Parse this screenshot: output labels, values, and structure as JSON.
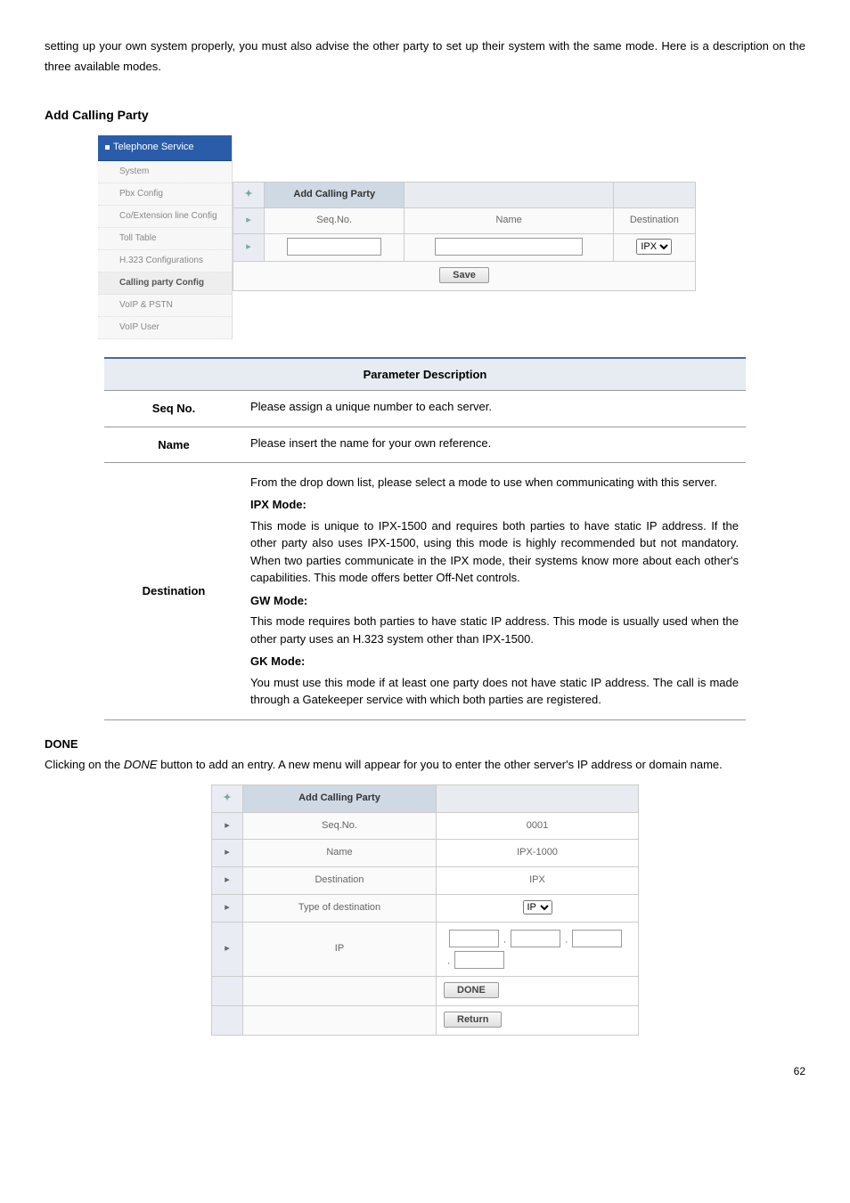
{
  "intro": "setting up your own system properly, you must also advise the other party to set up their system with the same mode. Here is a description on the three available modes.",
  "section_title": "Add Calling Party",
  "sidebar": {
    "header": "Telephone Service",
    "items": [
      {
        "label": "System"
      },
      {
        "label": "Pbx Config"
      },
      {
        "label": "Co/Extension line Config"
      },
      {
        "label": "Toll Table"
      },
      {
        "label": "H.323 Configurations"
      },
      {
        "label": "Calling party Config",
        "selected": true
      },
      {
        "label": "VoIP & PSTN"
      },
      {
        "label": "VoIP User"
      }
    ]
  },
  "form1": {
    "title": "Add Calling Party",
    "cols": {
      "seq": "Seq.No.",
      "name": "Name",
      "dest": "Destination"
    },
    "dest_option": "IPX",
    "save": "Save"
  },
  "param": {
    "title": "Parameter Description",
    "rows": {
      "seq": {
        "label": "Seq No.",
        "desc": "Please assign a unique number to each server."
      },
      "name": {
        "label": "Name",
        "desc": "Please insert the name for your own reference."
      },
      "dest": {
        "label": "Destination",
        "intro": "From the drop down list, please select a mode to use when communicating with this server.",
        "ipx_title": "IPX Mode:",
        "ipx_desc": "This mode is unique to IPX-1500 and requires both parties to have static IP address. If the other party also uses IPX-1500, using this mode is highly recommended but not mandatory. When two parties communicate in the IPX mode, their systems know more about each other's capabilities. This mode offers better Off-Net controls.",
        "gw_title": "GW Mode:",
        "gw_desc": "This mode requires both parties to have static IP address. This mode is usually used when the other party uses an H.323 system other than IPX-1500.",
        "gk_title": "GK Mode:",
        "gk_desc": "You must use this mode if at least one party does not have static IP address. The call is made through a Gatekeeper service with which both parties are registered."
      }
    }
  },
  "done": {
    "title": "DONE",
    "text_pre": "Clicking on the ",
    "text_btn": "DONE",
    "text_post": " button to add an entry. A new menu will appear for you to enter the other server's IP address or domain name."
  },
  "form2": {
    "title": "Add Calling Party",
    "rows": {
      "seq": {
        "label": "Seq.No.",
        "value": "0001"
      },
      "name": {
        "label": "Name",
        "value": "IPX-1000"
      },
      "dest": {
        "label": "Destination",
        "value": "IPX"
      },
      "type": {
        "label": "Type of destination",
        "option": "IP"
      },
      "ip": {
        "label": "IP"
      }
    },
    "done_btn": "DONE",
    "return_btn": "Return"
  },
  "page_num": "62",
  "chart_data": {
    "type": "table",
    "title": "Parameter Description",
    "rows": [
      {
        "parameter": "Seq No.",
        "description": "Please assign a unique number to each server."
      },
      {
        "parameter": "Name",
        "description": "Please insert the name for your own reference."
      },
      {
        "parameter": "Destination",
        "description": "Select a mode (IPX / GW / GK) to use when communicating with this server. IPX Mode: unique to IPX-1500, both parties need static IP, recommended if other party also uses IPX-1500, offers better Off-Net controls. GW Mode: both parties need static IP, usually used when other party uses an H.323 system other than IPX-1500. GK Mode: use if at least one party lacks static IP; call goes through a Gatekeeper service both parties are registered with."
      }
    ]
  }
}
